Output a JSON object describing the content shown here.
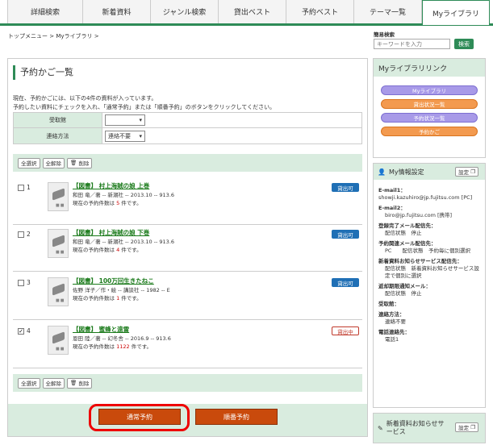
{
  "nav": {
    "tabs": [
      "詳細検索",
      "新着資料",
      "ジャンル検索",
      "貸出ベスト",
      "予約ベスト",
      "テーマ一覧",
      "Myライブラリ"
    ]
  },
  "breadcrumb": "トップメニュー > Myライブラリ >",
  "search": {
    "label": "簡易検索",
    "placeholder": "キーワードを入力",
    "button": "検索"
  },
  "page": {
    "title": "予約かご一覧",
    "intro_line1": "現在、予約かごには、以下の4件の資料が入っています。",
    "intro_line2": "予約したい資料にチェックを入れ、「通常予約」または「順番予約」のボタンをクリックしてください。"
  },
  "form": {
    "pickup_label": "受取館",
    "pickup_value": "",
    "contact_label": "連絡方法",
    "contact_value": "連絡不要"
  },
  "toolbar": {
    "select_all": "全選択",
    "deselect_all": "全解除",
    "delete": "削除"
  },
  "items": [
    {
      "num": "1",
      "checked": false,
      "title": "【図書】 村上海賊の娘 上巻",
      "meta1": "和田 竜／著 -- 新潮社 -- 2013.10 -- 913.6",
      "meta2_pre": "現在の予約件数は ",
      "count": "5",
      "meta2_post": " 件です。",
      "badge": "貸出可"
    },
    {
      "num": "2",
      "checked": false,
      "title": "【図書】 村上海賊の娘 下巻",
      "meta1": "和田 竜／著 -- 新潮社 -- 2013.10 -- 913.6",
      "meta2_pre": "現在の予約件数は ",
      "count": "4",
      "meta2_post": " 件です。",
      "badge": "貸出可"
    },
    {
      "num": "3",
      "checked": false,
      "title": "【図書】 100万回生きたねこ",
      "meta1": "佐野 洋子／作・絵 -- 講談社 -- 1982 -- E",
      "meta2_pre": "現在の予約件数は ",
      "count": "1",
      "meta2_post": " 件です。",
      "badge": "貸出可"
    },
    {
      "num": "4",
      "checked": true,
      "title": "【図書】 蜜蜂と遠雷",
      "meta1": "恩田 陸／著 -- 幻冬舎 -- 2016.9 -- 913.6",
      "meta2_pre": "現在の予約件数は ",
      "count": "1122",
      "meta2_post": " 件です。",
      "badge": "貸出中"
    }
  ],
  "buttons": {
    "normal": "通常予約",
    "order": "順番予約"
  },
  "side_links": {
    "title": "Myライブラリリンク",
    "items": [
      "Myライブラリ",
      "貸出状況一覧",
      "予約状況一覧",
      "予約かご"
    ]
  },
  "my_info": {
    "title": "My情報設定",
    "setting": "設定",
    "email1_label": "E-mail1：",
    "email1_value": "showji.kazuhiro@jp.fujitsu.com [PC]",
    "email2_label": "E-mail2：",
    "email2_value": "biro@jp.fujitsu.com [携帯]",
    "reg_label": "登録完了メール配信先：",
    "reg_value": "配信状態　停止",
    "resv_label": "予約関連メール配信先：",
    "resv_value": "PC　　配信状態　予約毎に個別選択",
    "new_label": "新着資料お知らせサービス配信先：",
    "new_value": "配信状態　新着資料お知らせサービス設定で個別に選択",
    "due_label": "返却期限通知メール：",
    "due_value": "配信状態　停止",
    "pickup_label": "受取館：",
    "pickup_value": "",
    "contact_label": "連絡方法：",
    "contact_value": "連絡不要",
    "phone_label": "電話連絡先：",
    "phone_value": "電話1"
  },
  "new_service": {
    "title": "新着資料お知らせサービス",
    "setting": "設定"
  }
}
